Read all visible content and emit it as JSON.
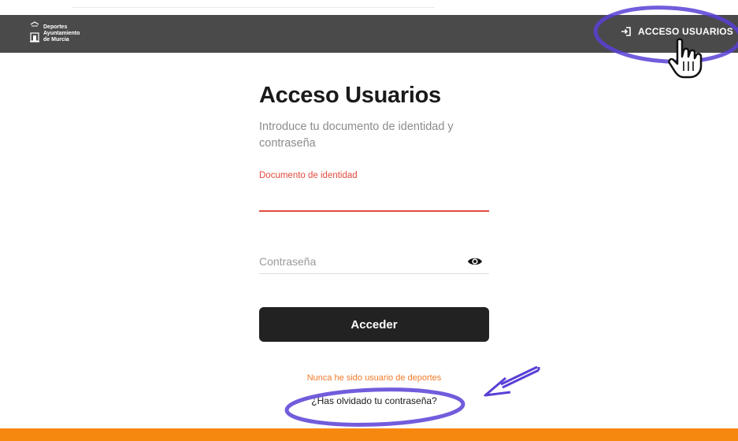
{
  "header": {
    "logo": {
      "line1": "Deportes",
      "line2": "Ayuntamiento",
      "line3": "de Murcia"
    },
    "access_button_label": "ACCESO USUARIOS",
    "access_icon": "login-icon"
  },
  "login": {
    "title": "Acceso Usuarios",
    "subtitle": "Introduce tu documento de identidad y contraseña",
    "document_field": {
      "label": "Documento de identidad",
      "value": ""
    },
    "password_field": {
      "placeholder": "Contraseña",
      "value": "",
      "toggle_icon": "eye-icon"
    },
    "submit_label": "Acceder",
    "register_link": "Nunca he sido usuario de deportes",
    "forgot_link": "¿Has olvidado tu contraseña?"
  },
  "colors": {
    "header_bg": "#4a4a4a",
    "accent_red": "#e34b3e",
    "link_orange": "#f07a2a",
    "footer_orange": "#f7880f",
    "button_dark": "#222222",
    "annotation_purple": "#5a3fd6"
  }
}
